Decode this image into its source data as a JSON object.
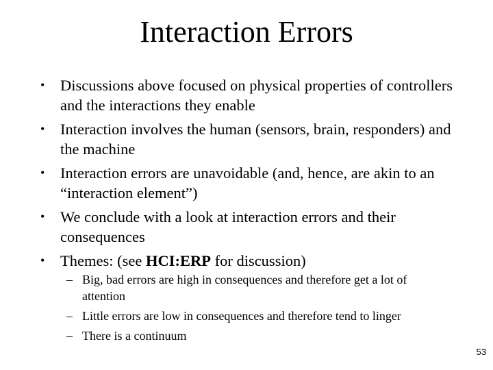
{
  "slide": {
    "title": "Interaction Errors",
    "bullet_marker": "•",
    "sub_marker": "–",
    "bullets": [
      {
        "text": "Discussions above focused on physical properties of controllers and the interactions they enable"
      },
      {
        "text": "Interaction involves the human (sensors, brain, responders) and the machine"
      },
      {
        "text": "Interaction errors are unavoidable (and, hence, are akin to an “interaction element”)"
      },
      {
        "text": "We conclude with a look at interaction errors and their consequences"
      },
      {
        "prefix": "Themes: (see ",
        "ref": "HCI:ERP",
        "suffix": " for discussion)"
      }
    ],
    "sub_bullets": [
      {
        "text": "Big, bad errors are high in consequences and therefore get a lot of attention"
      },
      {
        "text": "Little errors are low in consequences and therefore tend to linger"
      },
      {
        "text": "There is a continuum"
      }
    ],
    "page_number": "53"
  }
}
